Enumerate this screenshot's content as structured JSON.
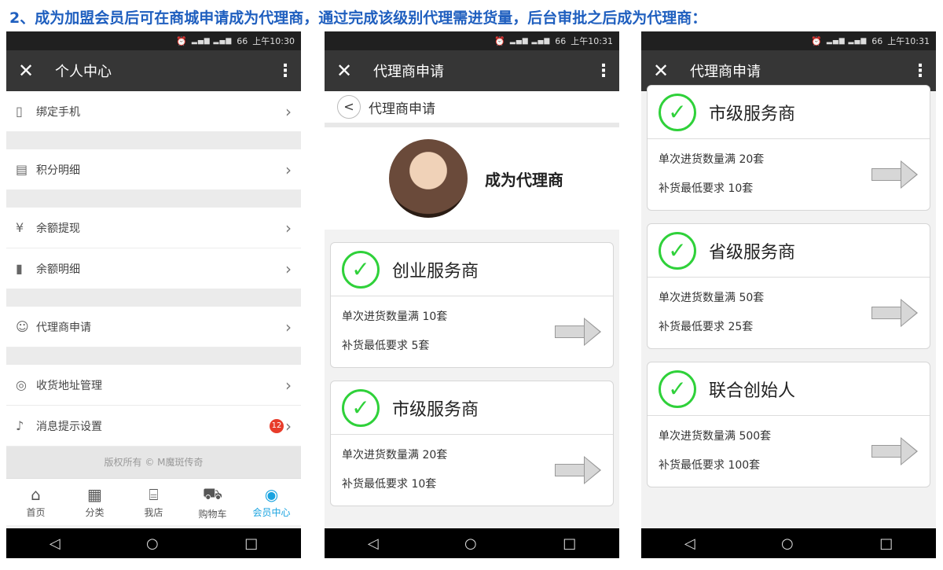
{
  "heading": "2、成为加盟会员后可在商城申请成为代理商，通过完成该级别代理需进货量，后台审批之后成为代理商：",
  "status": {
    "p1": "上午10:30",
    "p2": "上午10:31",
    "p3": "上午10:31",
    "battery": "66"
  },
  "phone1": {
    "title": "个人中心",
    "items": [
      {
        "label": "绑定手机",
        "icon": "phone-icon"
      },
      {
        "label": "积分明细",
        "icon": "points-icon"
      },
      {
        "label": "余额提现",
        "icon": "yen-icon"
      },
      {
        "label": "余额明细",
        "icon": "bar-chart-icon"
      },
      {
        "label": "代理商申请",
        "icon": "users-icon"
      },
      {
        "label": "收货地址管理",
        "icon": "location-icon"
      },
      {
        "label": "消息提示设置",
        "icon": "bell-icon",
        "badge": "12"
      }
    ],
    "copyright": "版权所有 © M魔斑传奇",
    "tabs": [
      {
        "label": "首页"
      },
      {
        "label": "分类"
      },
      {
        "label": "我店"
      },
      {
        "label": "购物车"
      },
      {
        "label": "会员中心"
      }
    ]
  },
  "phone2": {
    "title": "代理商申请",
    "sub_title": "代理商申请",
    "profile_name": "成为代理商",
    "cards": [
      {
        "level": "创业服务商",
        "line1": "单次进货数量满 10套",
        "line2": "补货最低要求 5套"
      },
      {
        "level": "市级服务商",
        "line1": "单次进货数量满 20套",
        "line2": "补货最低要求 10套"
      }
    ]
  },
  "phone3": {
    "title": "代理商申请",
    "cards": [
      {
        "level": "市级服务商",
        "line1": "单次进货数量满 20套",
        "line2": "补货最低要求 10套"
      },
      {
        "level": "省级服务商",
        "line1": "单次进货数量满 50套",
        "line2": "补货最低要求 25套"
      },
      {
        "level": "联合创始人",
        "line1": "单次进货数量满 500套",
        "line2": "补货最低要求 100套"
      }
    ]
  },
  "colors": {
    "accent": "#19a3e0",
    "check": "#2fd13a",
    "heading": "#1f5fbf",
    "titlebar": "#363636"
  }
}
